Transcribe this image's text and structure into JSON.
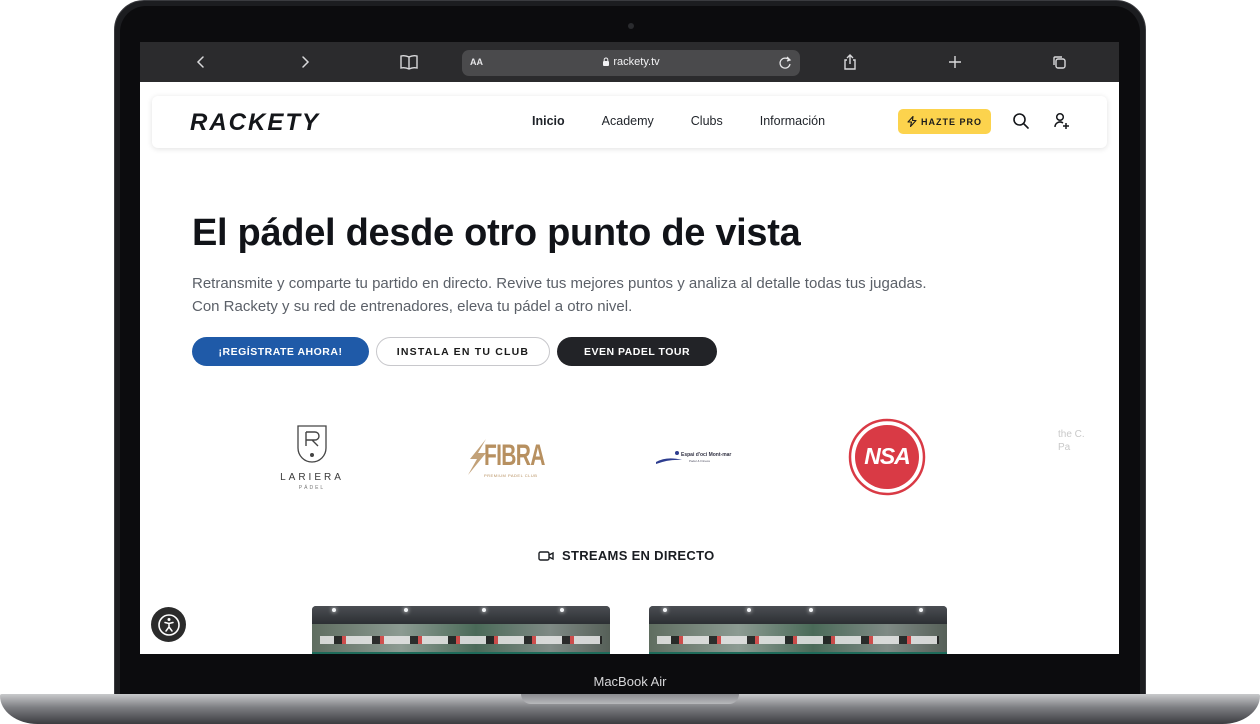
{
  "device": {
    "model_label": "MacBook Air"
  },
  "browser": {
    "reader_label": "AA",
    "url": "rackety.tv"
  },
  "site": {
    "logo": "RACKETY",
    "nav": [
      {
        "label": "Inicio",
        "active": true
      },
      {
        "label": "Academy",
        "active": false
      },
      {
        "label": "Clubs",
        "active": false
      },
      {
        "label": "Información",
        "active": false
      }
    ],
    "pro_button": "HAZTE PRO"
  },
  "hero": {
    "title": "El pádel desde otro punto de vista",
    "line1": "Retransmite y comparte tu partido en directo. Revive tus mejores puntos y analiza al detalle todas tus jugadas.",
    "line2": "Con Rackety y su red de entrenadores, eleva tu pádel a otro nivel.",
    "cta_primary": "¡REGÍSTRATE AHORA!",
    "cta_secondary": "INSTALA EN TU CLUB",
    "cta_tertiary": "EVEN PADEL TOUR"
  },
  "partners": {
    "lariera_name": "LARIERA",
    "lariera_sub": "PÁDEL",
    "fibra_name": "FIBRA",
    "fibra_tag": "PREMIUM PADEL CLUB",
    "espai_name": "Espai d'oci Mont-mar",
    "espai_tag": "Padel & Fitness",
    "nsa_name": "NSA",
    "partial_text": "the C. Pa"
  },
  "streams": {
    "heading": "STREAMS EN DIRECTO"
  },
  "colors": {
    "primary": "#1f5aa8",
    "dark": "#222327",
    "pro": "#fcd34d",
    "nsa_red": "#d93a45"
  }
}
